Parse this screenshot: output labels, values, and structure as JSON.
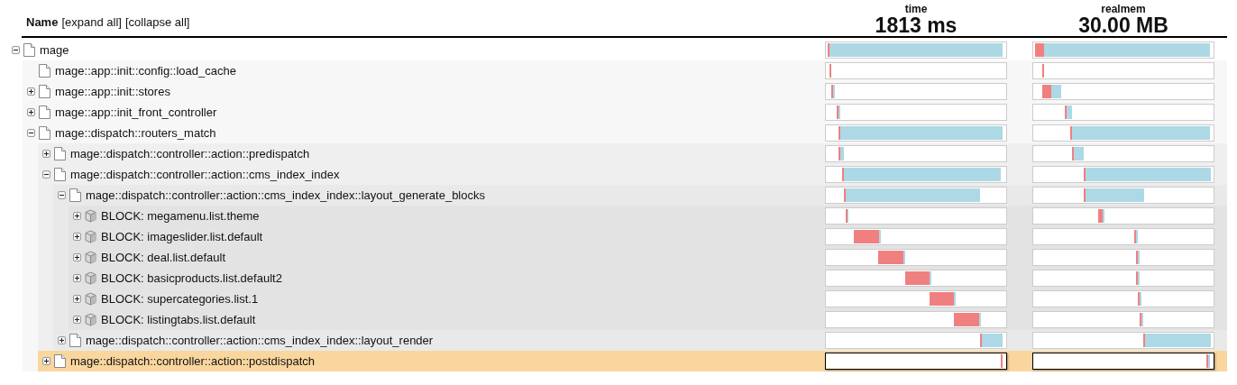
{
  "header": {
    "name": "Name",
    "links": [
      "[expand all]",
      "[collapse all]"
    ],
    "columns": [
      {
        "label": "time",
        "total": "1813 ms"
      },
      {
        "label": "realmem",
        "total": "30.00 MB"
      }
    ]
  },
  "tree": [
    {
      "label": "mage",
      "kind": "page",
      "expanded": true,
      "selected": false,
      "children": [
        {
          "label": "mage::app::init::config::load_cache",
          "kind": "leaf",
          "selected": false
        },
        {
          "label": "mage::app::init::stores",
          "kind": "page",
          "expanded": false,
          "selected": false
        },
        {
          "label": "mage::app::init_front_controller",
          "kind": "page",
          "expanded": false,
          "selected": false
        },
        {
          "label": "mage::dispatch::routers_match",
          "kind": "page",
          "expanded": true,
          "selected": false,
          "children": [
            {
              "label": "mage::dispatch::controller::action::predispatch",
              "kind": "page",
              "expanded": false,
              "selected": false
            },
            {
              "label": "mage::dispatch::controller::action::cms_index_index",
              "kind": "page",
              "expanded": true,
              "selected": false,
              "children": [
                {
                  "label": "mage::dispatch::controller::action::cms_index_index::layout_generate_blocks",
                  "kind": "page",
                  "expanded": true,
                  "selected": false,
                  "children": [
                    {
                      "label": "BLOCK: megamenu.list.theme",
                      "kind": "block",
                      "expanded": false,
                      "selected": false
                    },
                    {
                      "label": "BLOCK: imageslider.list.default",
                      "kind": "block",
                      "expanded": false,
                      "selected": false
                    },
                    {
                      "label": "BLOCK: deal.list.default",
                      "kind": "block",
                      "expanded": false,
                      "selected": false
                    },
                    {
                      "label": "BLOCK: basicproducts.list.default2",
                      "kind": "block",
                      "expanded": false,
                      "selected": false
                    },
                    {
                      "label": "BLOCK: supercategories.list.1",
                      "kind": "block",
                      "expanded": false,
                      "selected": false
                    },
                    {
                      "label": "BLOCK: listingtabs.list.default",
                      "kind": "block",
                      "expanded": false,
                      "selected": false
                    }
                  ]
                },
                {
                  "label": "mage::dispatch::controller::action::cms_index_index::layout_render",
                  "kind": "page",
                  "expanded": false,
                  "selected": false
                }
              ]
            },
            {
              "label": "mage::dispatch::controller::action::postdispatch",
              "kind": "page",
              "expanded": false,
              "selected": true
            }
          ]
        }
      ]
    }
  ]
}
